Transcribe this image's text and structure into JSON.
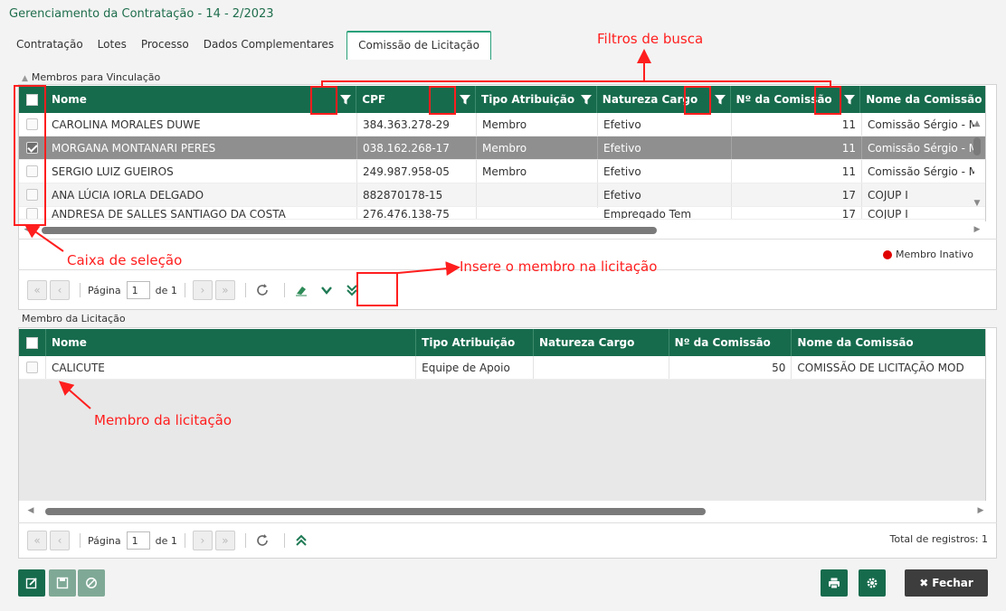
{
  "window": {
    "title": "Gerenciamento da Contratação - 14 - 2/2023"
  },
  "tabs": [
    "Contratação",
    "Lotes",
    "Processo",
    "Dados Complementares",
    "Comissão de Licitação"
  ],
  "members_section": {
    "title": "Membros para Vinculação",
    "columns": [
      "Nome",
      "CPF",
      "Tipo Atribuição",
      "Natureza Cargo",
      "Nº da Comissão",
      "Nome da Comissão"
    ],
    "rows": [
      {
        "nome": "CAROLINA MORALES DUWE",
        "cpf": "384.363.278-29",
        "tipo": "Membro",
        "natureza": "Efetivo",
        "num": "11",
        "comissao": "Comissão Sérgio - M"
      },
      {
        "nome": "MORGANA MONTANARI PERES",
        "cpf": "038.162.268-17",
        "tipo": "Membro",
        "natureza": "Efetivo",
        "num": "11",
        "comissao": "Comissão Sérgio - M"
      },
      {
        "nome": "SERGIO LUIZ GUEIROS",
        "cpf": "249.987.958-05",
        "tipo": "Membro",
        "natureza": "Efetivo",
        "num": "11",
        "comissao": "Comissão Sérgio - M"
      },
      {
        "nome": "ANA LÚCIA IORLA DELGADO",
        "cpf": "882870178-15",
        "tipo": "",
        "natureza": "Efetivo",
        "num": "17",
        "comissao": "COJUP I"
      },
      {
        "nome": "ANDRESA DE SALLES SANTIAGO DA COSTA",
        "cpf": "276.476.138-75",
        "tipo": "",
        "natureza": "Empregado Tem",
        "num": "17",
        "comissao": "COJUP I"
      }
    ],
    "selected_row": "MORGANA MONTANARI PERES",
    "legend": "Membro Inativo",
    "pager": {
      "page_label": "Página",
      "page": "1",
      "of_label": "de 1"
    }
  },
  "licitacao_section": {
    "title": "Membro da Licitação",
    "columns": [
      "Nome",
      "Tipo Atribuição",
      "Natureza Cargo",
      "Nº da Comissão",
      "Nome da Comissão"
    ],
    "rows": [
      {
        "nome": "CALICUTE",
        "tipo": "Equipe de Apoio",
        "natureza": "",
        "num": "50",
        "comissao": "COMISSÃO DE LICITAÇÃO MOD"
      }
    ],
    "pager": {
      "page_label": "Página",
      "page": "1",
      "of_label": "de 1",
      "total": "Total de registros: 1"
    }
  },
  "annotations": {
    "filters": "Filtros de busca",
    "checkbox": "Caixa de seleção",
    "insert": "Insere o membro na licitação",
    "member": "Membro da licitação"
  },
  "footer": {
    "close_label": "Fechar"
  },
  "colors": {
    "header_green": "#176b4d",
    "annotation_red": "#ff1e1e",
    "accent_teal": "#2aa07a"
  }
}
